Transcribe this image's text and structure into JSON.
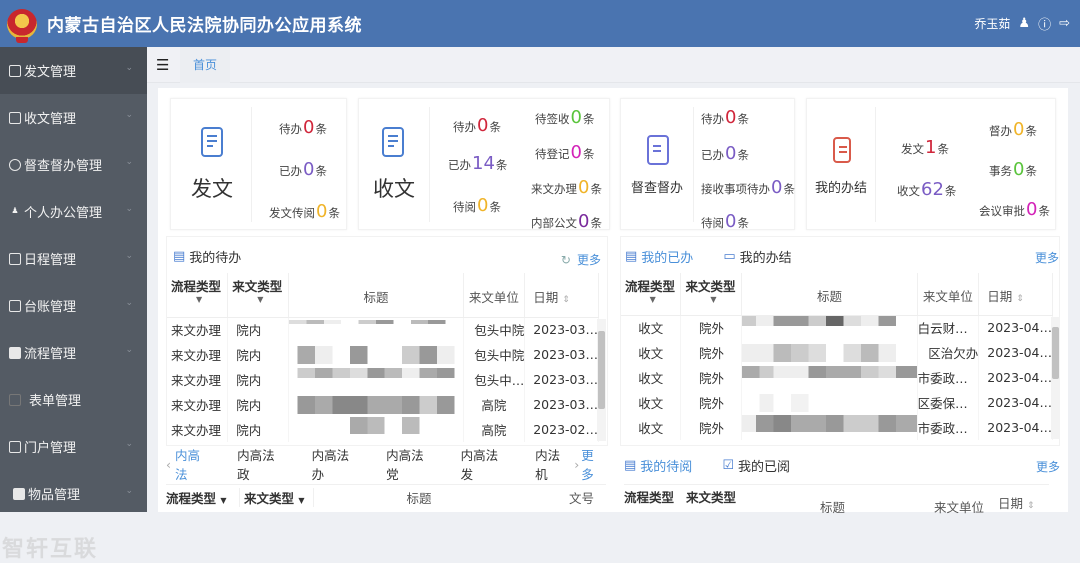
{
  "header": {
    "title": "内蒙古自治区人民法院协同办公应用系统",
    "user": "乔玉茹",
    "icons": [
      "user-icon",
      "info-icon",
      "logout-icon"
    ]
  },
  "sidebar": {
    "items": [
      {
        "label": "发文管理",
        "icon": "document-icon",
        "active": true
      },
      {
        "label": "收文管理",
        "icon": "inbox-icon"
      },
      {
        "label": "督查督办管理",
        "icon": "target-icon"
      },
      {
        "label": "个人办公管理",
        "icon": "person-icon"
      },
      {
        "label": "日程管理",
        "icon": "calendar-icon"
      },
      {
        "label": "台账管理",
        "icon": "ledger-icon"
      },
      {
        "label": "流程管理",
        "icon": "flow-icon"
      },
      {
        "label": "表单管理",
        "icon": "form-icon"
      },
      {
        "label": "门户管理",
        "icon": "portal-icon"
      },
      {
        "label": "物品管理",
        "icon": "goods-icon"
      }
    ],
    "watermark": "智轩互联"
  },
  "topbar": {
    "home_tab": "首页"
  },
  "cards": {
    "fawen": {
      "title": "发文",
      "stats": [
        {
          "pre": "待办",
          "num": "0",
          "post": "条",
          "color": "#d0263b"
        },
        {
          "pre": "已办",
          "num": "0",
          "post": "条",
          "color": "#7a5cc4"
        },
        {
          "pre": "发文传阅",
          "num": "0",
          "post": "条",
          "color": "#f0b429"
        }
      ]
    },
    "shouwen": {
      "title": "收文",
      "stats": [
        {
          "pre": "待办",
          "num": "0",
          "post": "条",
          "color": "#d0263b"
        },
        {
          "pre": "已办",
          "num": "14",
          "post": "条",
          "color": "#7a5cc4"
        },
        {
          "pre": "待阅",
          "num": "0",
          "post": "条",
          "color": "#f0b429"
        },
        {
          "pre": "待签收",
          "num": "0",
          "post": "条",
          "color": "#5ac43c"
        },
        {
          "pre": "待登记",
          "num": "0",
          "post": "条",
          "color": "#d323b8"
        },
        {
          "pre": "来文办理",
          "num": "0",
          "post": "条",
          "color": "#f0b429"
        },
        {
          "pre": "内部公文",
          "num": "0",
          "post": "条",
          "color": "#7a2b9c"
        }
      ]
    },
    "ducha": {
      "title": "督查督办",
      "stats": [
        {
          "pre": "待办",
          "num": "0",
          "post": "条",
          "color": "#d0263b"
        },
        {
          "pre": "已办",
          "num": "0",
          "post": "条",
          "color": "#7a5cc4"
        },
        {
          "pre": "接收事项待办",
          "num": "0",
          "post": "条",
          "color": "#7a5cc4"
        },
        {
          "pre": "待阅",
          "num": "0",
          "post": "条",
          "color": "#7a5cc4"
        }
      ]
    },
    "banjie": {
      "title": "我的办结",
      "stats": [
        {
          "pre": "发文",
          "num": "1",
          "post": "条",
          "color": "#d0263b"
        },
        {
          "pre": "收文",
          "num": "62",
          "post": "条",
          "color": "#7a5cc4"
        },
        {
          "pre": "督办",
          "num": "0",
          "post": "条",
          "color": "#f0b429"
        },
        {
          "pre": "事务",
          "num": "0",
          "post": "条",
          "color": "#5ac43c"
        },
        {
          "pre": "会议审批",
          "num": "0",
          "post": "条",
          "color": "#d323b8"
        }
      ]
    }
  },
  "todo": {
    "title": "我的待办",
    "more": "更多",
    "columns": [
      "流程类型",
      "来文类型",
      "标题",
      "来文单位",
      "日期"
    ],
    "rows": [
      {
        "flow": "来文办理",
        "type": "院内",
        "unit": "包头中院",
        "date": "2023-03…"
      },
      {
        "flow": "来文办理",
        "type": "院内",
        "unit": "包头中院",
        "date": "2023-03…"
      },
      {
        "flow": "来文办理",
        "type": "院内",
        "unit": "包头中…",
        "date": "2023-03…"
      },
      {
        "flow": "来文办理",
        "type": "院内",
        "unit": "高院",
        "date": "2023-03…"
      },
      {
        "flow": "来文办理",
        "type": "院内",
        "unit": "高院",
        "date": "2023-02…"
      }
    ]
  },
  "done": {
    "tab_active": "我的已办",
    "tab_other": "我的办结",
    "more": "更多",
    "columns": [
      "流程类型",
      "来文类型",
      "标题",
      "来文单位",
      "日期"
    ],
    "rows": [
      {
        "flow": "收文",
        "type": "院外",
        "unit": "白云财…",
        "date": "2023-04…"
      },
      {
        "flow": "收文",
        "type": "院外",
        "unit": "区治欠办",
        "date": "2023-04…"
      },
      {
        "flow": "收文",
        "type": "院外",
        "unit": "市委政…",
        "date": "2023-04…"
      },
      {
        "flow": "收文",
        "type": "院外",
        "unit": "区委保…",
        "date": "2023-04…"
      },
      {
        "flow": "收文",
        "type": "院外",
        "unit": "市委政…",
        "date": "2023-04…"
      }
    ]
  },
  "neigao": {
    "tabs": [
      "内高法",
      "内高法政",
      "内高法办",
      "内高法党",
      "内高法发",
      "内法机"
    ],
    "more": "更多",
    "columns": [
      "流程类型",
      "来文类型",
      "标题",
      "文号"
    ]
  },
  "read": {
    "tab_active": "我的待阅",
    "tab_other": "我的已阅",
    "more": "更多",
    "columns": [
      "流程类型",
      "来文类型",
      "标题",
      "来文单位",
      "日期"
    ]
  }
}
